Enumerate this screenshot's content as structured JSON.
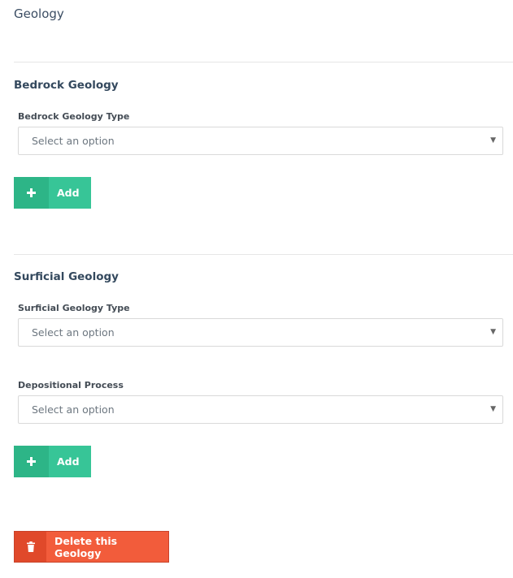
{
  "page": {
    "title": "Geology"
  },
  "bedrock": {
    "section_title": "Bedrock Geology",
    "type_field": {
      "label": "Bedrock Geology Type",
      "placeholder": "Select an option"
    },
    "add_label": "Add"
  },
  "surficial": {
    "section_title": "Surficial Geology",
    "type_field": {
      "label": "Surficial Geology Type",
      "placeholder": "Select an option"
    },
    "process_field": {
      "label": "Depositional Process",
      "placeholder": "Select an option"
    },
    "add_label": "Add"
  },
  "delete": {
    "label": "Delete this Geology"
  },
  "icons": {
    "add": "plus-icon",
    "delete": "trash-icon",
    "dropdown": "caret-down-icon"
  },
  "colors": {
    "add_button": "#37c597",
    "delete_button": "#f25c3b"
  }
}
